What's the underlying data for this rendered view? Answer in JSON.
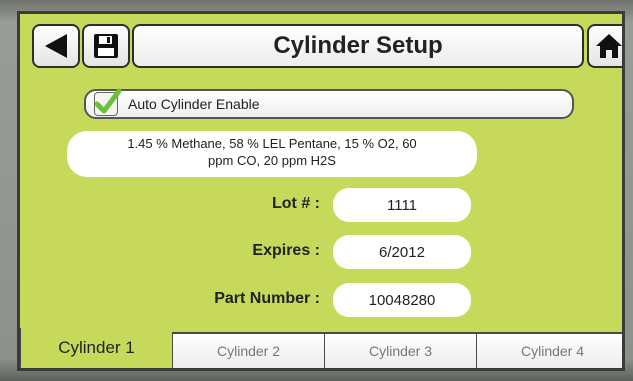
{
  "header": {
    "title": "Cylinder Setup",
    "back_icon": "back-arrow-icon",
    "save_icon": "floppy-disk-icon",
    "home_icon": "home-icon"
  },
  "auto_cylinder": {
    "label": "Auto Cylinder Enable",
    "checked": true
  },
  "gas_description": {
    "line1": "1.45 % Methane, 58 % LEL Pentane, 15 % O2, 60",
    "line2": "ppm CO, 20 ppm H2S"
  },
  "fields": {
    "lot": {
      "label": "Lot # :",
      "value": "1111"
    },
    "expires": {
      "label": "Expires :",
      "value": "6/2012"
    },
    "part_number": {
      "label": "Part Number :",
      "value": "10048280"
    }
  },
  "tabs": [
    {
      "label": "Cylinder 1",
      "active": true
    },
    {
      "label": "Cylinder 2",
      "active": false
    },
    {
      "label": "Cylinder 3",
      "active": false
    },
    {
      "label": "Cylinder 4",
      "active": false
    }
  ],
  "colors": {
    "screen_background": "#c6d95a",
    "check_green": "#6bbf3a"
  }
}
